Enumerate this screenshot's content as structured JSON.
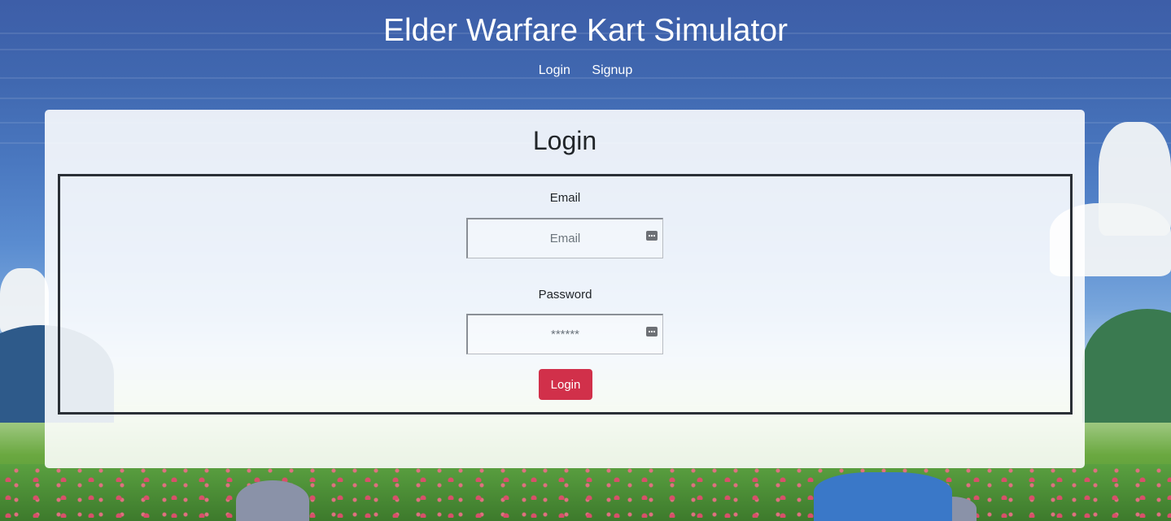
{
  "header": {
    "title": "Elder Warfare Kart Simulator",
    "nav": [
      {
        "label": "Login"
      },
      {
        "label": "Signup"
      }
    ]
  },
  "login_form": {
    "title": "Login",
    "email": {
      "label": "Email",
      "placeholder": "Email",
      "value": ""
    },
    "password": {
      "label": "Password",
      "placeholder": "******",
      "value": ""
    },
    "submit_label": "Login",
    "field_icon": "password-manager-key-icon"
  },
  "colors": {
    "submit_button": "#d1304a",
    "form_border": "#2a2f36",
    "header_text": "#ffffff",
    "sky": "#3d5ea8"
  },
  "background": {
    "description_icon": "pixel-art-landscape"
  }
}
